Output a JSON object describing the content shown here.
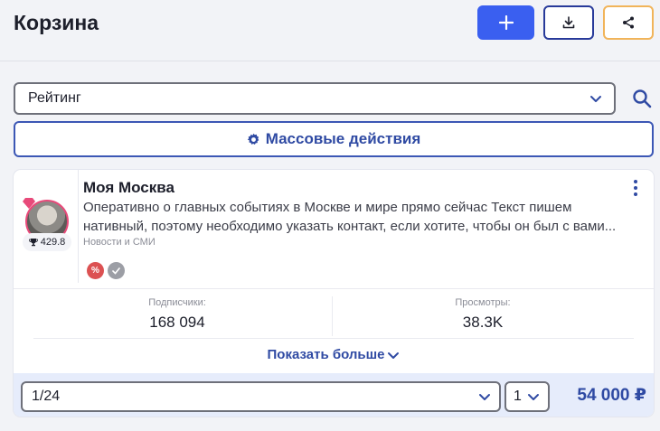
{
  "header": {
    "title": "Корзина",
    "add_icon": "plus-icon",
    "download_icon": "download-icon",
    "share_icon": "share-icon"
  },
  "sort": {
    "value": "Рейтинг",
    "search_icon": "search-icon"
  },
  "bulk_actions": {
    "label": "Массовые действия",
    "icon": "gear-icon"
  },
  "channel": {
    "name": "Моя Москва",
    "description": "Оперативно о главных событиях в Москве и мире прямо сейчас Текст пишем нативный, поэтому необходимо указать контакт, если хотите, чтобы он был с вами...",
    "category": "Новости и СМИ",
    "rating": "429.8",
    "tags": [
      "discount-icon",
      "verified-icon"
    ],
    "subscribers_label": "Подписчики:",
    "subscribers_value": "168 094",
    "views_label": "Просмотры:",
    "views_value": "38.3K",
    "show_more_label": "Показать больше",
    "format_value": "1/24",
    "quantity_value": "1",
    "price": "54 000 ₽"
  },
  "colors": {
    "primary": "#3a5ff0",
    "accent_text": "#2f4aa3",
    "share_border": "#f1b45a",
    "footer_bg": "#e6ecfb"
  }
}
